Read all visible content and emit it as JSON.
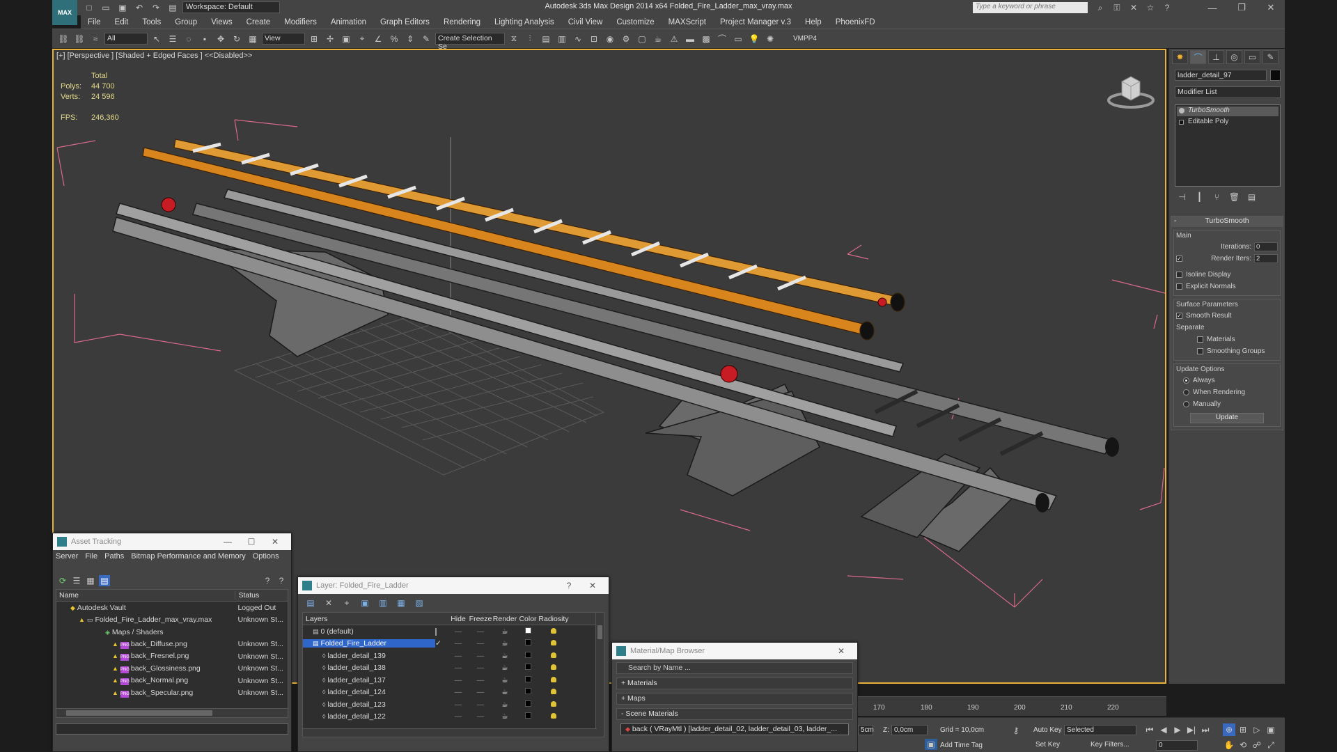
{
  "app": {
    "title": "Autodesk 3ds Max Design 2014 x64     Folded_Fire_Ladder_max_vray.max",
    "workspace": "Workspace: Default",
    "keyword_placeholder": "Type a keyword or phrase",
    "logo": "MAX"
  },
  "menu": [
    "File",
    "Edit",
    "Tools",
    "Group",
    "Views",
    "Create",
    "Modifiers",
    "Animation",
    "Graph Editors",
    "Rendering",
    "Lighting Analysis",
    "Civil View",
    "Customize",
    "MAXScript",
    "Project Manager v.3",
    "Help",
    "PhoenixFD"
  ],
  "toolbar": {
    "selection_filter": "All",
    "ref_coord": "View",
    "named_selection": "Create Selection Se",
    "vmpp": "VMPP4"
  },
  "viewport": {
    "label": "[+] [Perspective ] [Shaded + Edged Faces ]  <<Disabled>>",
    "stats": {
      "total_label": "Total",
      "polys_label": "Polys:",
      "polys": "44 700",
      "verts_label": "Verts:",
      "verts": "24 596",
      "fps_label": "FPS:",
      "fps": "246,360"
    }
  },
  "command_panel": {
    "object_name": "ladder_detail_97",
    "modifier_list": "Modifier List",
    "stack": [
      "TurboSmooth",
      "Editable Poly"
    ],
    "rollout": "TurboSmooth",
    "main_label": "Main",
    "iterations_label": "Iterations:",
    "iterations": "0",
    "render_iters_label": "Render Iters:",
    "render_iters": "2",
    "isoline": "Isoline Display",
    "explicit": "Explicit Normals",
    "surface_label": "Surface Parameters",
    "smooth_result": "Smooth Result",
    "separate": "Separate",
    "materials": "Materials",
    "smoothing_groups": "Smoothing Groups",
    "update_label": "Update Options",
    "always": "Always",
    "when_rendering": "When Rendering",
    "manually": "Manually",
    "update_btn": "Update"
  },
  "asset_tracking": {
    "title": "Asset Tracking",
    "menu": [
      "Server",
      "File",
      "Paths",
      "Bitmap Performance and Memory",
      "Options"
    ],
    "col_name": "Name",
    "col_status": "Status",
    "rows": [
      {
        "name": "Autodesk Vault",
        "status": "Logged Out",
        "indent": 0
      },
      {
        "name": "Folded_Fire_Ladder_max_vray.max",
        "status": "Unknown St...",
        "indent": 1
      },
      {
        "name": "Maps / Shaders",
        "status": "",
        "indent": 2
      },
      {
        "name": "back_Diffuse.png",
        "status": "Unknown St...",
        "indent": 3
      },
      {
        "name": "back_Fresnel.png",
        "status": "Unknown St...",
        "indent": 3
      },
      {
        "name": "back_Glossiness.png",
        "status": "Unknown St...",
        "indent": 3
      },
      {
        "name": "back_Normal.png",
        "status": "Unknown St...",
        "indent": 3
      },
      {
        "name": "back_Specular.png",
        "status": "Unknown St...",
        "indent": 3
      }
    ]
  },
  "layers": {
    "title": "Layer: Folded_Fire_Ladder",
    "help": "?",
    "cols": [
      "Layers",
      "Hide",
      "Freeze",
      "Render",
      "Color",
      "Radiosity"
    ],
    "rows": [
      {
        "name": "0 (default)",
        "indent": 0
      },
      {
        "name": "Folded_Fire_Ladder",
        "indent": 0,
        "selected": true
      },
      {
        "name": "ladder_detail_139",
        "indent": 1
      },
      {
        "name": "ladder_detail_138",
        "indent": 1
      },
      {
        "name": "ladder_detail_137",
        "indent": 1
      },
      {
        "name": "ladder_detail_124",
        "indent": 1
      },
      {
        "name": "ladder_detail_123",
        "indent": 1
      },
      {
        "name": "ladder_detail_122",
        "indent": 1
      }
    ]
  },
  "material_browser": {
    "title": "Material/Map Browser",
    "search_placeholder": "Search by Name ...",
    "sections": [
      "+ Materials",
      "+ Maps",
      "- Scene Materials"
    ],
    "item": "back ( VRayMtl ) [ladder_detail_02, ladder_detail_03, ladder_..."
  },
  "timeline": {
    "ticks": [
      "170",
      "180",
      "190",
      "200",
      "210",
      "220"
    ]
  },
  "status": {
    "x_val": "5cm",
    "z_label": "Z:",
    "z_val": "0,0cm",
    "grid": "Grid = 10,0cm",
    "auto_key": "Auto Key",
    "selected": "Selected",
    "set_key": "Set Key",
    "key_filters": "Key Filters...",
    "add_time_tag": "Add Time Tag",
    "frame": "0"
  },
  "colors": {
    "accent_border": "#e8b13a",
    "selection_blue": "#2f66c9",
    "ladder_orange": "#d8851e",
    "bounding_pink": "#d86a8a"
  }
}
